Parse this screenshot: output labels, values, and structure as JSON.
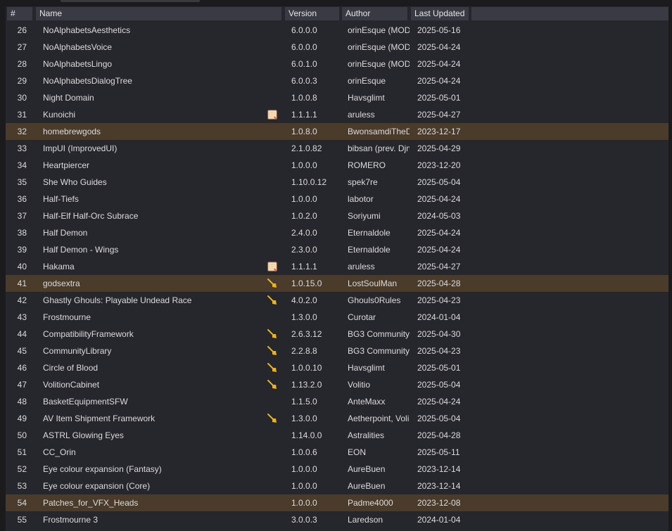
{
  "columns": {
    "num": "#",
    "name": "Name",
    "version": "Version",
    "author": "Author",
    "updated": "Last Updated"
  },
  "colors": {
    "row_highlight": "#4a3b2b",
    "header_bg": "#3a3a44",
    "table_bg": "#26262d",
    "broom_icon": "#e8b325",
    "scroll_icon": "#e0a070"
  },
  "rows": [
    {
      "num": "26",
      "name": "NoAlphabetsAesthetics",
      "version": "6.0.0.0",
      "author": "orinEsque (MOD",
      "updated": "2025-05-16",
      "icon": "",
      "highlight": false
    },
    {
      "num": "27",
      "name": "NoAlphabetsVoice",
      "version": "6.0.0.0",
      "author": "orinEsque (MOD",
      "updated": "2025-04-24",
      "icon": "",
      "highlight": false
    },
    {
      "num": "28",
      "name": "NoAlphabetsLingo",
      "version": "6.0.1.0",
      "author": "orinEsque (MOD",
      "updated": "2025-04-24",
      "icon": "",
      "highlight": false
    },
    {
      "num": "29",
      "name": "NoAlphabetsDialogTree",
      "version": "6.0.0.3",
      "author": "orinEsque",
      "updated": "2025-04-24",
      "icon": "",
      "highlight": false
    },
    {
      "num": "30",
      "name": "Night Domain",
      "version": "1.0.0.8",
      "author": "Havsglimt",
      "updated": "2025-05-01",
      "icon": "",
      "highlight": false
    },
    {
      "num": "31",
      "name": "Kunoichi",
      "version": "1.1.1.1",
      "author": "aruless",
      "updated": "2025-04-27",
      "icon": "scroll-icon",
      "highlight": false
    },
    {
      "num": "32",
      "name": "homebrewgods",
      "version": "1.0.8.0",
      "author": "BwonsamdiTheD",
      "updated": "2023-12-17",
      "icon": "",
      "highlight": true
    },
    {
      "num": "33",
      "name": "ImpUI (ImprovedUI)",
      "version": "2.1.0.82",
      "author": "bibsan (prev. Djn",
      "updated": "2025-04-29",
      "icon": "",
      "highlight": false
    },
    {
      "num": "34",
      "name": "Heartpiercer",
      "version": "1.0.0.0",
      "author": "ROMERO",
      "updated": "2023-12-20",
      "icon": "",
      "highlight": false
    },
    {
      "num": "35",
      "name": "She Who Guides",
      "version": "1.10.0.12",
      "author": "spek7re",
      "updated": "2025-05-04",
      "icon": "",
      "highlight": false
    },
    {
      "num": "36",
      "name": "Half-Tiefs",
      "version": "1.0.0.0",
      "author": "labotor",
      "updated": "2025-04-24",
      "icon": "",
      "highlight": false
    },
    {
      "num": "37",
      "name": "Half-Elf Half-Orc Subrace",
      "version": "1.0.2.0",
      "author": "Soriyumi",
      "updated": "2024-05-03",
      "icon": "",
      "highlight": false
    },
    {
      "num": "38",
      "name": "Half Demon",
      "version": "2.4.0.0",
      "author": "Eternaldole",
      "updated": "2025-04-24",
      "icon": "",
      "highlight": false
    },
    {
      "num": "39",
      "name": "Half Demon - Wings",
      "version": "2.3.0.0",
      "author": "Eternaldole",
      "updated": "2025-04-24",
      "icon": "",
      "highlight": false
    },
    {
      "num": "40",
      "name": "Hakama",
      "version": "1.1.1.1",
      "author": "aruless",
      "updated": "2025-04-27",
      "icon": "scroll-icon",
      "highlight": false
    },
    {
      "num": "41",
      "name": "godsextra",
      "version": "1.0.15.0",
      "author": "LostSoulMan",
      "updated": "2025-04-28",
      "icon": "broom-icon",
      "highlight": true
    },
    {
      "num": "42",
      "name": "Ghastly Ghouls: Playable Undead Race",
      "version": "4.0.2.0",
      "author": "Ghouls0Rules",
      "updated": "2025-04-23",
      "icon": "broom-icon",
      "highlight": false
    },
    {
      "num": "43",
      "name": "Frostmourne",
      "version": "1.3.0.0",
      "author": "Curotar",
      "updated": "2024-01-04",
      "icon": "",
      "highlight": false
    },
    {
      "num": "44",
      "name": "CompatibilityFramework",
      "version": "2.6.3.12",
      "author": "BG3 Community",
      "updated": "2025-04-30",
      "icon": "broom-icon",
      "highlight": false
    },
    {
      "num": "45",
      "name": "CommunityLibrary",
      "version": "2.2.8.8",
      "author": "BG3 Community",
      "updated": "2025-04-23",
      "icon": "broom-icon",
      "highlight": false
    },
    {
      "num": "46",
      "name": "Circle of Blood",
      "version": "1.0.0.10",
      "author": "Havsglimt",
      "updated": "2025-05-01",
      "icon": "broom-icon",
      "highlight": false
    },
    {
      "num": "47",
      "name": "VolitionCabinet",
      "version": "1.13.2.0",
      "author": "Volitio",
      "updated": "2025-05-04",
      "icon": "broom-icon",
      "highlight": false
    },
    {
      "num": "48",
      "name": "BasketEquipmentSFW",
      "version": "1.1.5.0",
      "author": "AnteMaxx",
      "updated": "2025-04-24",
      "icon": "",
      "highlight": false
    },
    {
      "num": "49",
      "name": "AV Item Shipment Framework",
      "version": "1.3.0.0",
      "author": "Aetherpoint, Voli",
      "updated": "2025-05-04",
      "icon": "broom-icon",
      "highlight": false
    },
    {
      "num": "50",
      "name": "ASTRL Glowing Eyes",
      "version": "1.14.0.0",
      "author": "Astralities",
      "updated": "2025-04-28",
      "icon": "",
      "highlight": false
    },
    {
      "num": "51",
      "name": "CC_Orin",
      "version": "1.0.0.6",
      "author": "EON",
      "updated": "2025-05-11",
      "icon": "",
      "highlight": false
    },
    {
      "num": "52",
      "name": "Eye colour expansion (Fantasy)",
      "version": "1.0.0.0",
      "author": "AureBuen",
      "updated": "2023-12-14",
      "icon": "",
      "highlight": false
    },
    {
      "num": "53",
      "name": "Eye colour expansion (Core)",
      "version": "1.0.0.0",
      "author": "AureBuen",
      "updated": "2023-12-14",
      "icon": "",
      "highlight": false
    },
    {
      "num": "54",
      "name": "Patches_for_VFX_Heads",
      "version": "1.0.0.0",
      "author": "Padme4000",
      "updated": "2023-12-08",
      "icon": "",
      "highlight": true
    },
    {
      "num": "55",
      "name": "Frostmourne 3",
      "version": "3.0.0.3",
      "author": "Laredson",
      "updated": "2024-01-04",
      "icon": "",
      "highlight": false
    }
  ]
}
